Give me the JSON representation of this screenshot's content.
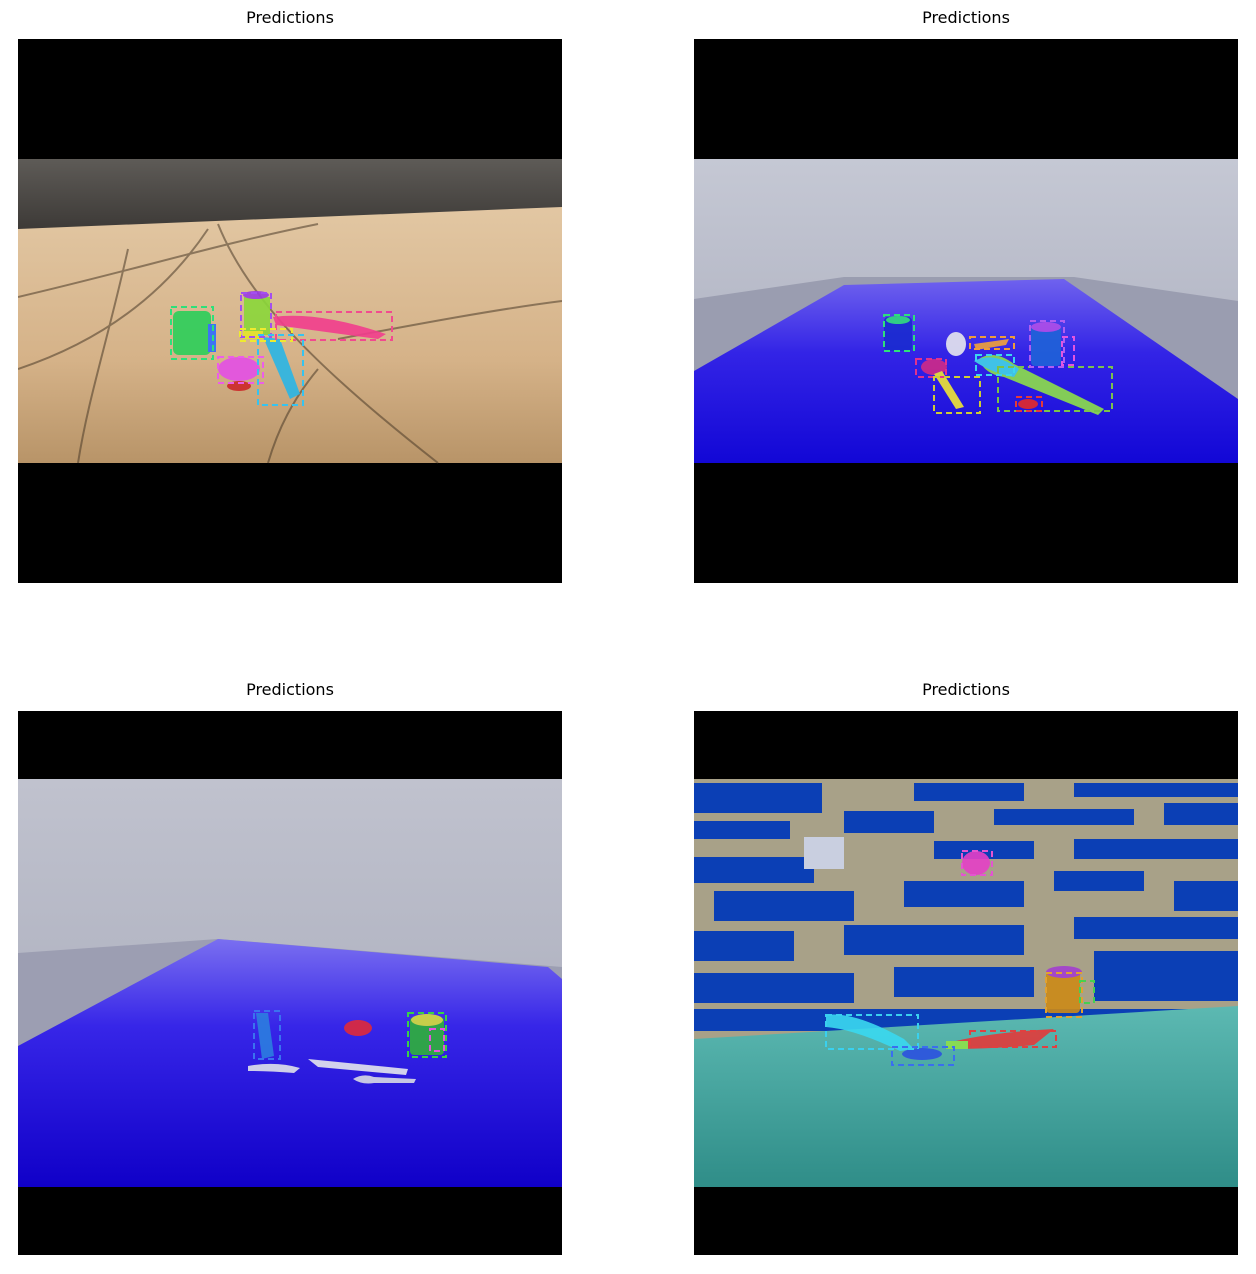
{
  "panels": [
    {
      "title": "Predictions"
    },
    {
      "title": "Predictions"
    },
    {
      "title": "Predictions"
    },
    {
      "title": "Predictions"
    }
  ],
  "colors": {
    "letterbox": "#000000",
    "wood_floor": "#d6b48c",
    "blue_table": "#1f16e0",
    "gray_wall": "#b5b8c7",
    "teal_floor": "#4aa8a4",
    "stripe_blue": "#0b3fb5",
    "stripe_beige": "#a8a188"
  }
}
